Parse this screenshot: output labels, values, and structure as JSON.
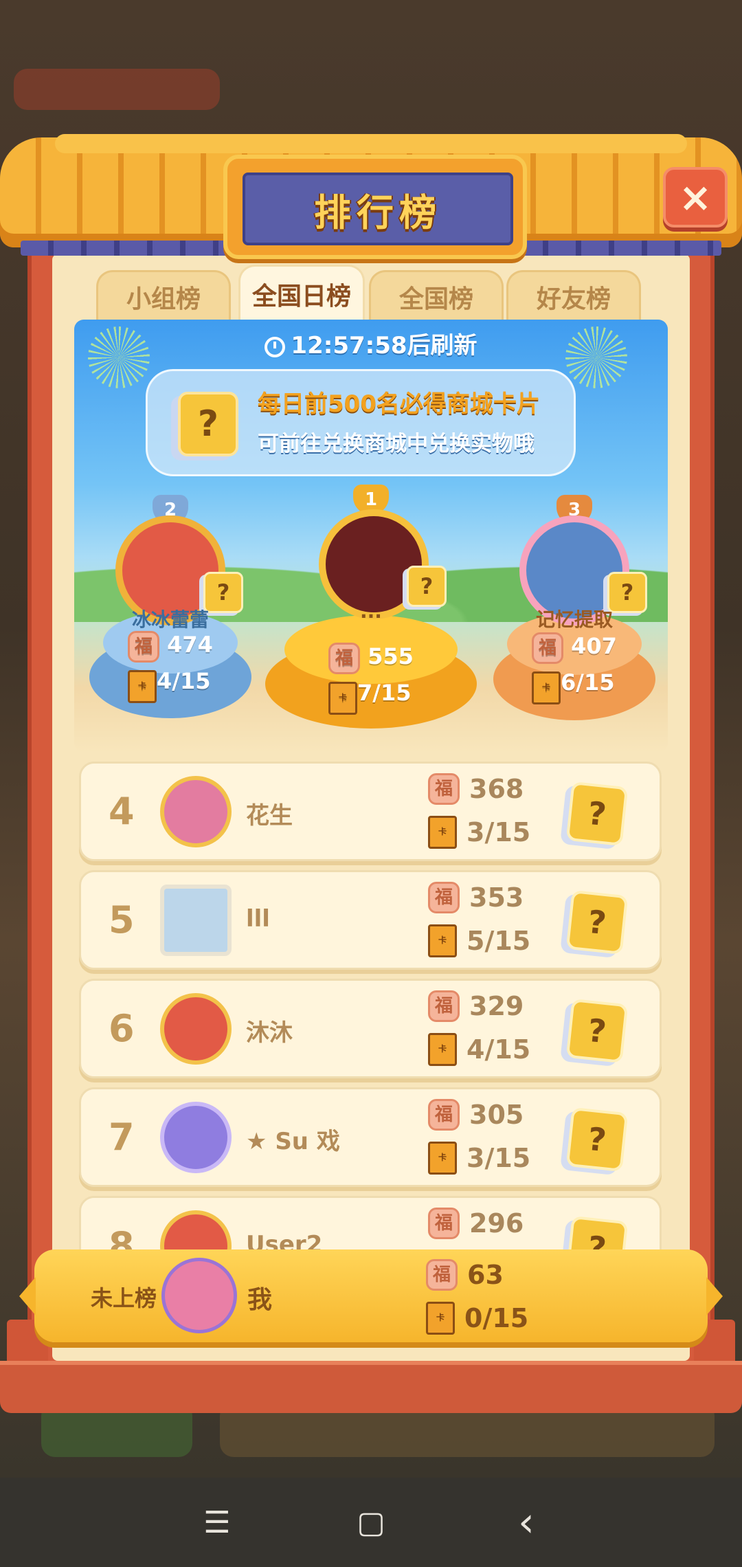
{
  "header": {
    "title": "排行榜",
    "close_label": "×"
  },
  "tabs": [
    {
      "label": "小组榜",
      "active": false
    },
    {
      "label": "全国日榜",
      "active": true
    },
    {
      "label": "全国榜",
      "active": false
    },
    {
      "label": "好友榜",
      "active": false
    }
  ],
  "hero": {
    "refresh_time": "12:57:58",
    "refresh_suffix": "后刷新",
    "info_line1": "每日前500名必得商城卡片",
    "info_line2": "可前往兑换商城中兑换实物哦",
    "question_mark": "?"
  },
  "podium": [
    {
      "rank": "2",
      "name": "冰冰蕾蕾",
      "score": "474",
      "cards": "4/15"
    },
    {
      "rank": "1",
      "name": "...",
      "score": "555",
      "cards": "7/15"
    },
    {
      "rank": "3",
      "name": "记忆提取",
      "score": "407",
      "cards": "6/15"
    }
  ],
  "list": [
    {
      "rank": "4",
      "name": "花生",
      "score": "368",
      "cards": "3/15"
    },
    {
      "rank": "5",
      "name": "lll",
      "score": "353",
      "cards": "5/15"
    },
    {
      "rank": "6",
      "name": "沐沐",
      "score": "329",
      "cards": "4/15"
    },
    {
      "rank": "7",
      "name": "★ Su 戏",
      "score": "305",
      "cards": "3/15"
    },
    {
      "rank": "8",
      "name": "User2",
      "score": "296",
      "cards": ""
    }
  ],
  "icons": {
    "fu": "福",
    "book": "卡"
  },
  "me": {
    "status": "未上榜",
    "name": "我",
    "score": "63",
    "cards": "0/15"
  },
  "nav": {
    "menu": "☰",
    "home": "▢",
    "back": "‹"
  },
  "colors": {
    "frame": "#d65b3c",
    "gold": "#f6b52c",
    "sky": "#3f9cef",
    "panel": "#f8e6bc"
  }
}
